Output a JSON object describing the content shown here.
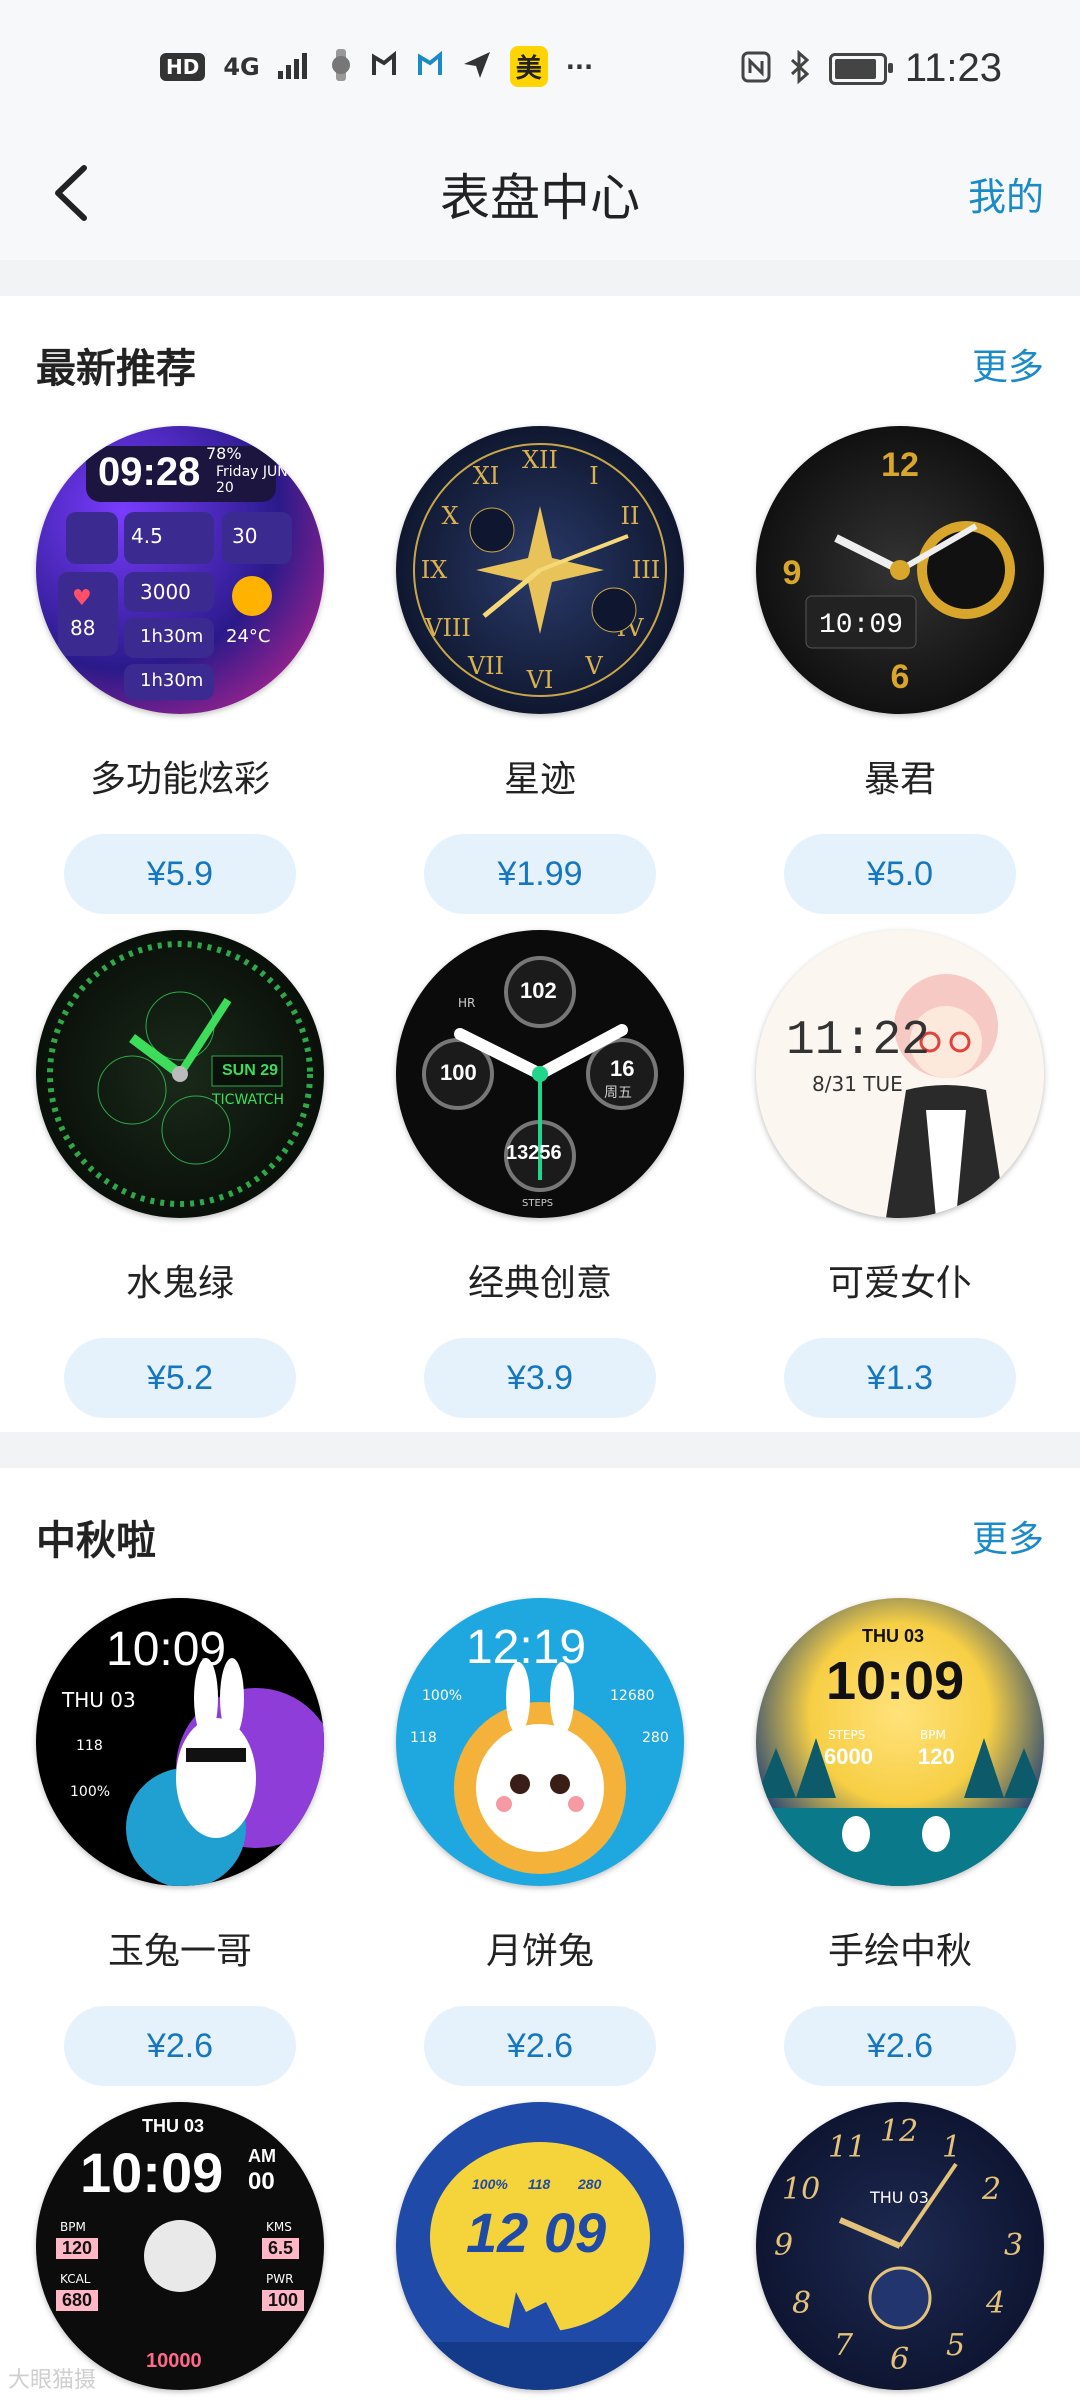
{
  "status_bar": {
    "hd": "HD",
    "network": "4G",
    "app_badge": "美",
    "more": "···",
    "time": "11:23"
  },
  "header": {
    "title": "表盘中心",
    "mine_label": "我的"
  },
  "sections": [
    {
      "title": "最新推荐",
      "more_label": "更多",
      "items": [
        {
          "name": "多功能炫彩",
          "price": "¥5.9"
        },
        {
          "name": "星迹",
          "price": "¥1.99"
        },
        {
          "name": "暴君",
          "price": "¥5.0"
        },
        {
          "name": "水鬼绿",
          "price": "¥5.2"
        },
        {
          "name": "经典创意",
          "price": "¥3.9"
        },
        {
          "name": "可爱女仆",
          "price": "¥1.3"
        }
      ]
    },
    {
      "title": "中秋啦",
      "more_label": "更多",
      "items": [
        {
          "name": "玉兔一哥",
          "price": "¥2.6"
        },
        {
          "name": "月饼兔",
          "price": "¥2.6"
        },
        {
          "name": "手绘中秋",
          "price": "¥2.6"
        },
        {
          "name": "",
          "price": ""
        },
        {
          "name": "",
          "price": ""
        },
        {
          "name": "",
          "price": ""
        }
      ]
    }
  ],
  "faces": {
    "f1": {
      "time": "09:28",
      "date": "Friday JUN 20",
      "battery": "78%",
      "a": "4.5",
      "b": "30",
      "c": "3000",
      "d": "88",
      "e": "1h30m",
      "f": "24°C",
      "g": "1h30m"
    },
    "f4": {
      "day": "SUN",
      "num": "29",
      "brand": "TICWATCH"
    },
    "f5": {
      "top": "102",
      "left": "100",
      "right": "16",
      "right_sub": "周五",
      "bottom": "13256",
      "hr": "HR",
      "steps": "STEPS"
    },
    "f6": {
      "time": "11:22",
      "date": "8/31 TUE"
    },
    "f7": {
      "time": "10:09",
      "date": "THU 03",
      "hr": "118",
      "pct": "100%"
    },
    "f8": {
      "time": "12:19",
      "a": "100%",
      "b": "12680",
      "c": "118",
      "d": "280"
    },
    "f9": {
      "date": "THU 03",
      "time": "10:09",
      "steps_label": "STEPS",
      "steps": "6000",
      "bpm_label": "BPM",
      "bpm": "120"
    },
    "f10": {
      "date": "THU 03",
      "time": "10:09",
      "ampm": "AM",
      "sec": "00",
      "bpm_label": "BPM",
      "bpm": "120",
      "kms_label": "KMS",
      "kms": "6.5",
      "kcal_label": "KCAL",
      "kcal": "680",
      "pwr_label": "PWR",
      "pwr": "100",
      "steps": "10000"
    },
    "f11": {
      "a": "100%",
      "b": "118",
      "c": "280",
      "time": "12 09"
    },
    "f12": {
      "date": "THU 03",
      "n12": "12",
      "n3": "3",
      "n6": "6",
      "n9": "9",
      "n10": "10",
      "n2": "2",
      "n4": "4",
      "n5": "5",
      "n7": "7",
      "n8": "8",
      "n11": "11",
      "n1": "1"
    }
  },
  "watermark": "大眼猫摄"
}
